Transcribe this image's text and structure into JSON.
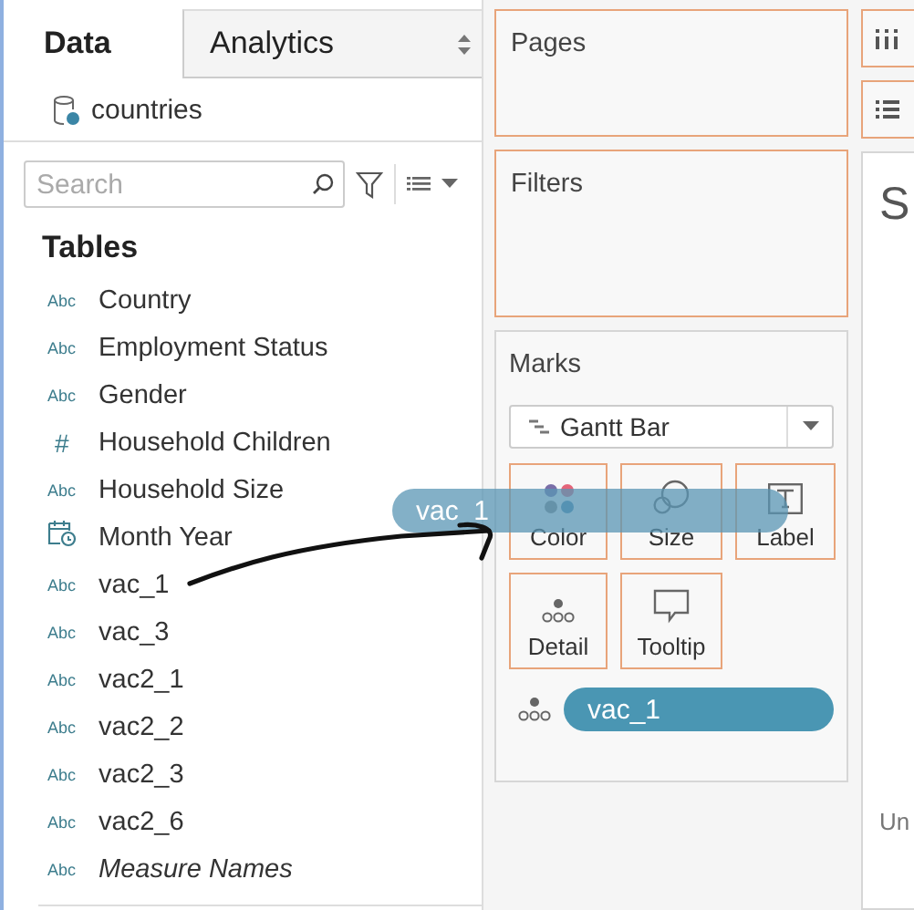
{
  "tabs": [
    {
      "label": "Data",
      "selected": true
    },
    {
      "label": "Analytics",
      "selected": false
    }
  ],
  "data_source": {
    "name": "countries"
  },
  "search": {
    "placeholder": "Search"
  },
  "tables_heading": "Tables",
  "fields": [
    {
      "name": "Country",
      "kind": "string",
      "type_label": "Abc",
      "italic": false
    },
    {
      "name": "Employment Status",
      "kind": "string",
      "type_label": "Abc",
      "italic": false
    },
    {
      "name": "Gender",
      "kind": "string",
      "type_label": "Abc",
      "italic": false
    },
    {
      "name": "Household Children",
      "kind": "number",
      "type_label": "#",
      "italic": false
    },
    {
      "name": "Household Size",
      "kind": "string",
      "type_label": "Abc",
      "italic": false
    },
    {
      "name": "Month Year",
      "kind": "date",
      "italic": false
    },
    {
      "name": "vac_1",
      "kind": "string",
      "type_label": "Abc",
      "italic": false
    },
    {
      "name": "vac_3",
      "kind": "string",
      "type_label": "Abc",
      "italic": false
    },
    {
      "name": "vac2_1",
      "kind": "string",
      "type_label": "Abc",
      "italic": false
    },
    {
      "name": "vac2_2",
      "kind": "string",
      "type_label": "Abc",
      "italic": false
    },
    {
      "name": "vac2_3",
      "kind": "string",
      "type_label": "Abc",
      "italic": false
    },
    {
      "name": "vac2_6",
      "kind": "string",
      "type_label": "Abc",
      "italic": false
    },
    {
      "name": "Measure Names",
      "kind": "string",
      "type_label": "Abc",
      "italic": true
    }
  ],
  "pages": {
    "title": "Pages"
  },
  "filters": {
    "title": "Filters"
  },
  "marks": {
    "title": "Marks",
    "mark_type": "Gantt Bar",
    "buttons": [
      {
        "label": "Color",
        "kind": "color"
      },
      {
        "label": "Size",
        "kind": "size"
      },
      {
        "label": "Label",
        "kind": "label"
      },
      {
        "label": "Detail",
        "kind": "detail"
      },
      {
        "label": "Tooltip",
        "kind": "tooltip"
      }
    ],
    "pills": [
      {
        "label": "vac_1",
        "kind": "detail"
      }
    ]
  },
  "drag_pill": {
    "label": "vac_1"
  },
  "view": {
    "title": "S",
    "footer": "Un"
  }
}
